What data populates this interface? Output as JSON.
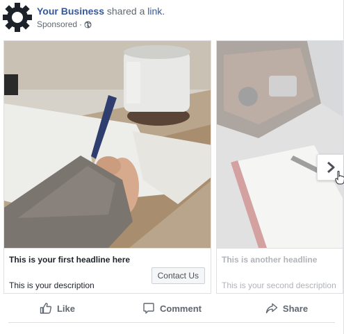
{
  "header": {
    "page_name": "Your Business",
    "action_text": "shared a",
    "link_text": "link.",
    "sponsored_label": "Sponsored",
    "separator": "·",
    "avatar_icon": "gear-icon",
    "privacy_icon": "globe-icon"
  },
  "cards": [
    {
      "headline": "This is your first headline here",
      "description": "This is your description",
      "cta_label": "Contact Us"
    },
    {
      "headline": "This is another headline",
      "description": "This is your second description"
    }
  ],
  "carousel": {
    "next_icon": "chevron-right-icon"
  },
  "actions": {
    "like_label": "Like",
    "comment_label": "Comment",
    "share_label": "Share"
  },
  "colors": {
    "brand_link": "#365899",
    "meta_text": "#616770",
    "action_text": "#606770",
    "border": "#dddfe2"
  }
}
